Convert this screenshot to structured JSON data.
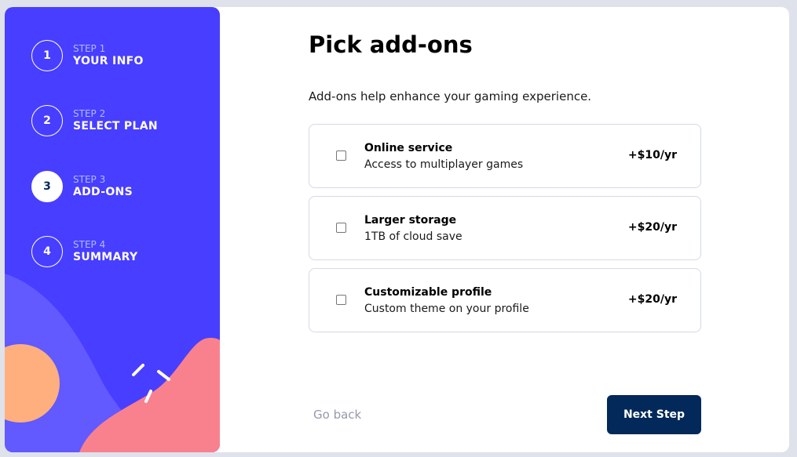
{
  "sidebar": {
    "steps": [
      {
        "number": "1",
        "label": "STEP 1",
        "title": "YOUR INFO"
      },
      {
        "number": "2",
        "label": "STEP 2",
        "title": "SELECT PLAN"
      },
      {
        "number": "3",
        "label": "STEP 3",
        "title": "ADD-ONS"
      },
      {
        "number": "4",
        "label": "STEP 4",
        "title": "SUMMARY"
      }
    ],
    "active_step": 3
  },
  "main": {
    "title": "Pick add-ons",
    "subtitle": "Add-ons help enhance your gaming experience.",
    "addons": [
      {
        "name": "Online service",
        "description": "Access to multiplayer games",
        "price": "+$10/yr",
        "checked": false
      },
      {
        "name": "Larger storage",
        "description": "1TB of cloud save",
        "price": "+$20/yr",
        "checked": false
      },
      {
        "name": "Customizable profile",
        "description": "Custom theme on your profile",
        "price": "+$20/yr",
        "checked": false
      }
    ]
  },
  "footer": {
    "back_label": "Go back",
    "next_label": "Next Step"
  },
  "colors": {
    "sidebar_bg": "#483eff",
    "primary_dark": "#022959",
    "step_label": "#abbcff",
    "border": "#d6d9e6",
    "muted": "#9699aa"
  }
}
